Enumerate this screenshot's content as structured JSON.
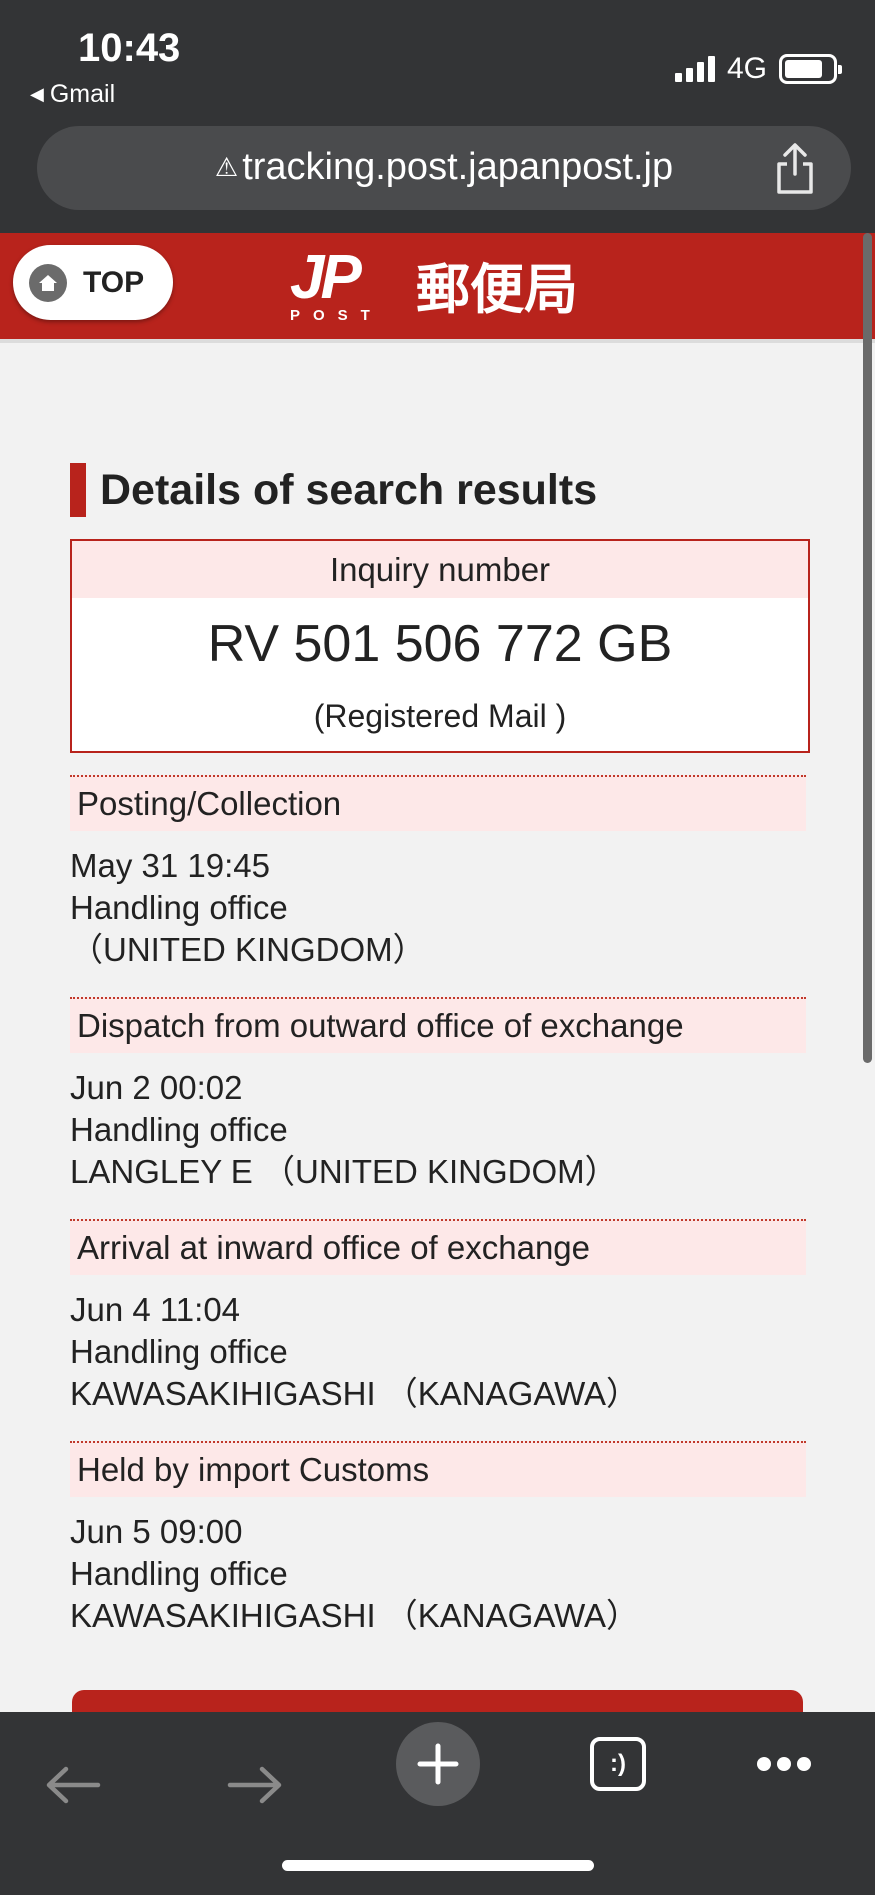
{
  "status_bar": {
    "time": "10:43",
    "back_app": "Gmail",
    "network": "4G"
  },
  "browser": {
    "url": "tracking.post.japanpost.jp"
  },
  "header": {
    "top_button": "TOP",
    "logo_mark": "JP",
    "logo_sub": "POST",
    "logo_kanji": "郵便局",
    "brand_color": "#b8231c"
  },
  "page": {
    "title": "Details of search results",
    "inquiry": {
      "label": "Inquiry number",
      "number": "RV 501 506 772 GB",
      "mail_type": "(Registered Mail )"
    },
    "events": [
      {
        "status": "Posting/Collection",
        "datetime": "May 31 19:45",
        "office_label": "Handling office",
        "office": "（UNITED KINGDOM）"
      },
      {
        "status": "Dispatch from outward office of exchange",
        "datetime": "Jun 2 00:02",
        "office_label": "Handling office",
        "office": "LANGLEY E （UNITED KINGDOM）"
      },
      {
        "status": "Arrival at inward office of exchange",
        "datetime": "Jun 4 11:04",
        "office_label": "Handling office",
        "office": "KAWASAKIHIGASHI （KANAGAWA）"
      },
      {
        "status": "Held by import Customs",
        "datetime": "Jun 5 09:00",
        "office_label": "Handling office",
        "office": "KAWASAKIHIGASHI （KANAGAWA）"
      }
    ]
  },
  "toolbar": {
    "icons": [
      "back-arrow-icon",
      "forward-arrow-icon",
      "new-tab-plus-icon",
      "tabs-icon",
      "more-icon"
    ],
    "tabs_glyph": ":)"
  }
}
